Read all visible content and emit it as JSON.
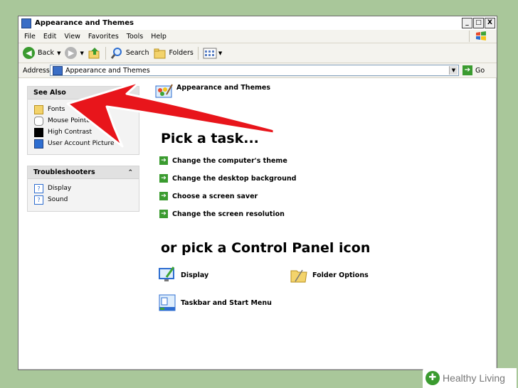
{
  "window": {
    "title": "Appearance and Themes"
  },
  "window_controls": {
    "minimize": "_",
    "restore": "□",
    "close": "X"
  },
  "menu": [
    "File",
    "Edit",
    "View",
    "Favorites",
    "Tools",
    "Help"
  ],
  "toolbar": {
    "back": "Back",
    "search": "Search",
    "folders": "Folders"
  },
  "address": {
    "label": "Address",
    "value": "Appearance and Themes",
    "go": "Go"
  },
  "see_also": {
    "title": "See Also",
    "items": [
      "Fonts",
      "Mouse Pointers",
      "High Contrast",
      "User Account Picture"
    ]
  },
  "troubleshooters": {
    "title": "Troubleshooters",
    "items": [
      "Display",
      "Sound"
    ]
  },
  "main": {
    "category_title": "Appearance and Themes",
    "pick_task": "Pick a task...",
    "tasks": [
      "Change the computer's theme",
      "Change the desktop background",
      "Choose a screen saver",
      "Change the screen resolution"
    ],
    "pick_icon": "or pick a Control Panel icon",
    "icons": [
      "Display",
      "Folder Options",
      "Taskbar and Start Menu"
    ]
  },
  "watermark": {
    "brand": "Healthy Living"
  },
  "colors": {
    "background": "#a9c79a",
    "go_green": "#3a9b2f",
    "arrow_red": "#e8151b"
  }
}
